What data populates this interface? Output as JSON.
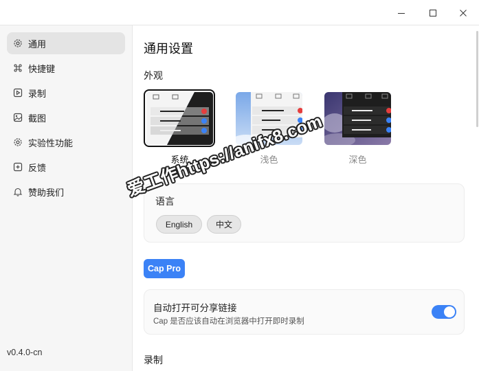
{
  "window": {
    "minimize_icon": "minimize-icon",
    "maximize_icon": "maximize-icon",
    "close_icon": "close-icon"
  },
  "sidebar": {
    "items": [
      {
        "label": "通用",
        "icon": "gear-icon",
        "active": true
      },
      {
        "label": "快捷键",
        "icon": "command-icon",
        "active": false
      },
      {
        "label": "录制",
        "icon": "record-icon",
        "active": false
      },
      {
        "label": "截图",
        "icon": "image-icon",
        "active": false
      },
      {
        "label": "实验性功能",
        "icon": "flask-icon",
        "active": false
      },
      {
        "label": "反馈",
        "icon": "feedback-icon",
        "active": false
      },
      {
        "label": "赞助我们",
        "icon": "bell-icon",
        "active": false
      }
    ],
    "version": "v0.4.0-cn"
  },
  "main": {
    "title": "通用设置",
    "appearance": {
      "label": "外观",
      "themes": [
        {
          "label": "系统",
          "selected": true
        },
        {
          "label": "浅色",
          "selected": false
        },
        {
          "label": "深色",
          "selected": false
        }
      ]
    },
    "language": {
      "label": "语言",
      "options": [
        "English",
        "中文"
      ]
    },
    "cap_pro": "Cap Pro",
    "auto_share": {
      "title": "自动打开可分享链接",
      "description": "Cap 是否应该自动在浏览器中打开即时录制",
      "enabled": true
    },
    "recording_label": "录制"
  },
  "watermark": "爱工作https://anifx8.com",
  "colors": {
    "accent": "#3b82f6",
    "sidebar_bg": "#f6f6f6",
    "active_bg": "#e4e4e4"
  }
}
